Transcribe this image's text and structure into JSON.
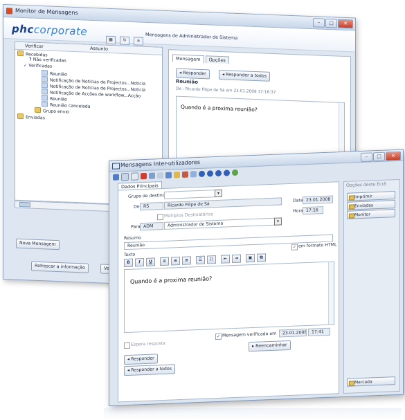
{
  "win1": {
    "title": "Monitor de Mensagens",
    "banner_logo_a": "phc",
    "banner_logo_b": "corporate",
    "banner_text": "Mensagens de Administrador de Sistema",
    "list": {
      "col_verificar": "Verificar",
      "col_assunto": "Assunto",
      "nodes": [
        {
          "label": "Recebidas",
          "kind": "folder"
        },
        {
          "label": "Não verificadas",
          "kind": "check"
        },
        {
          "label": "Verificadas",
          "kind": "check"
        },
        {
          "label": "Reunião",
          "kind": "env"
        },
        {
          "label": "Notificação de Noticias de Projectos...Noticia",
          "kind": "env"
        },
        {
          "label": "Notificação de Noticias de Projectos...Noticia",
          "kind": "env"
        },
        {
          "label": "Notificação de Acções de workflow...Acção",
          "kind": "env"
        },
        {
          "label": "Reunião",
          "kind": "env"
        },
        {
          "label": "Reunião cancelada",
          "kind": "env"
        },
        {
          "label": "Grupo envio",
          "kind": "folder"
        },
        {
          "label": "Enviadas",
          "kind": "folder"
        }
      ]
    },
    "btn_nova": "Nova Mensagem",
    "btn_refrescar": "Refrescar a informação",
    "btn_partial": "Ve",
    "tab_mensagem": "Mensagem",
    "tab_opcoes": "Opções",
    "btn_responder": "Responder",
    "btn_responder_todos": "Responder a todos",
    "subject": "Reunião",
    "from": "De : Ricardo Filipe de Sá em 23.01.2008 17:16:37",
    "body": "Quando é a proxima reunião?"
  },
  "win2": {
    "title": "Mensagens Inter-utilizadores",
    "tab_dados": "Dados Principais",
    "grupo_label": "Grupo de destino",
    "de_label": "De",
    "de_code": "RS",
    "de_name": "Ricardo Filipe de Sá",
    "data_label": "Data",
    "data_value": "23.01.2008",
    "multiplos_label": "Múltiplos Destinatários",
    "hora_label": "Hora",
    "hora_value": "17:16",
    "para_label": "Para",
    "para_code": "ADM",
    "para_name": "Administrador de Sistema",
    "resumo_label": "Resumo",
    "resumo_value": "Reunião",
    "texto_label": "Texto",
    "html_label": "em formato HTML",
    "body": "Quando é a proxima reunião?",
    "espera_label": "Espera resposta",
    "verificada_label": "Mensagem verificada em",
    "verificada_date": "23.01.2008",
    "verificada_time": "17:41",
    "btn_reencaminhar": "Reencaminhar",
    "btn_responder": "Responder",
    "btn_responder_todos": "Responder a todos",
    "side_header": "Opções deste Ecrã",
    "side_items": [
      "Imprimir",
      "Enviadas",
      "Monitor"
    ],
    "btn_marcada": "Marcada"
  }
}
